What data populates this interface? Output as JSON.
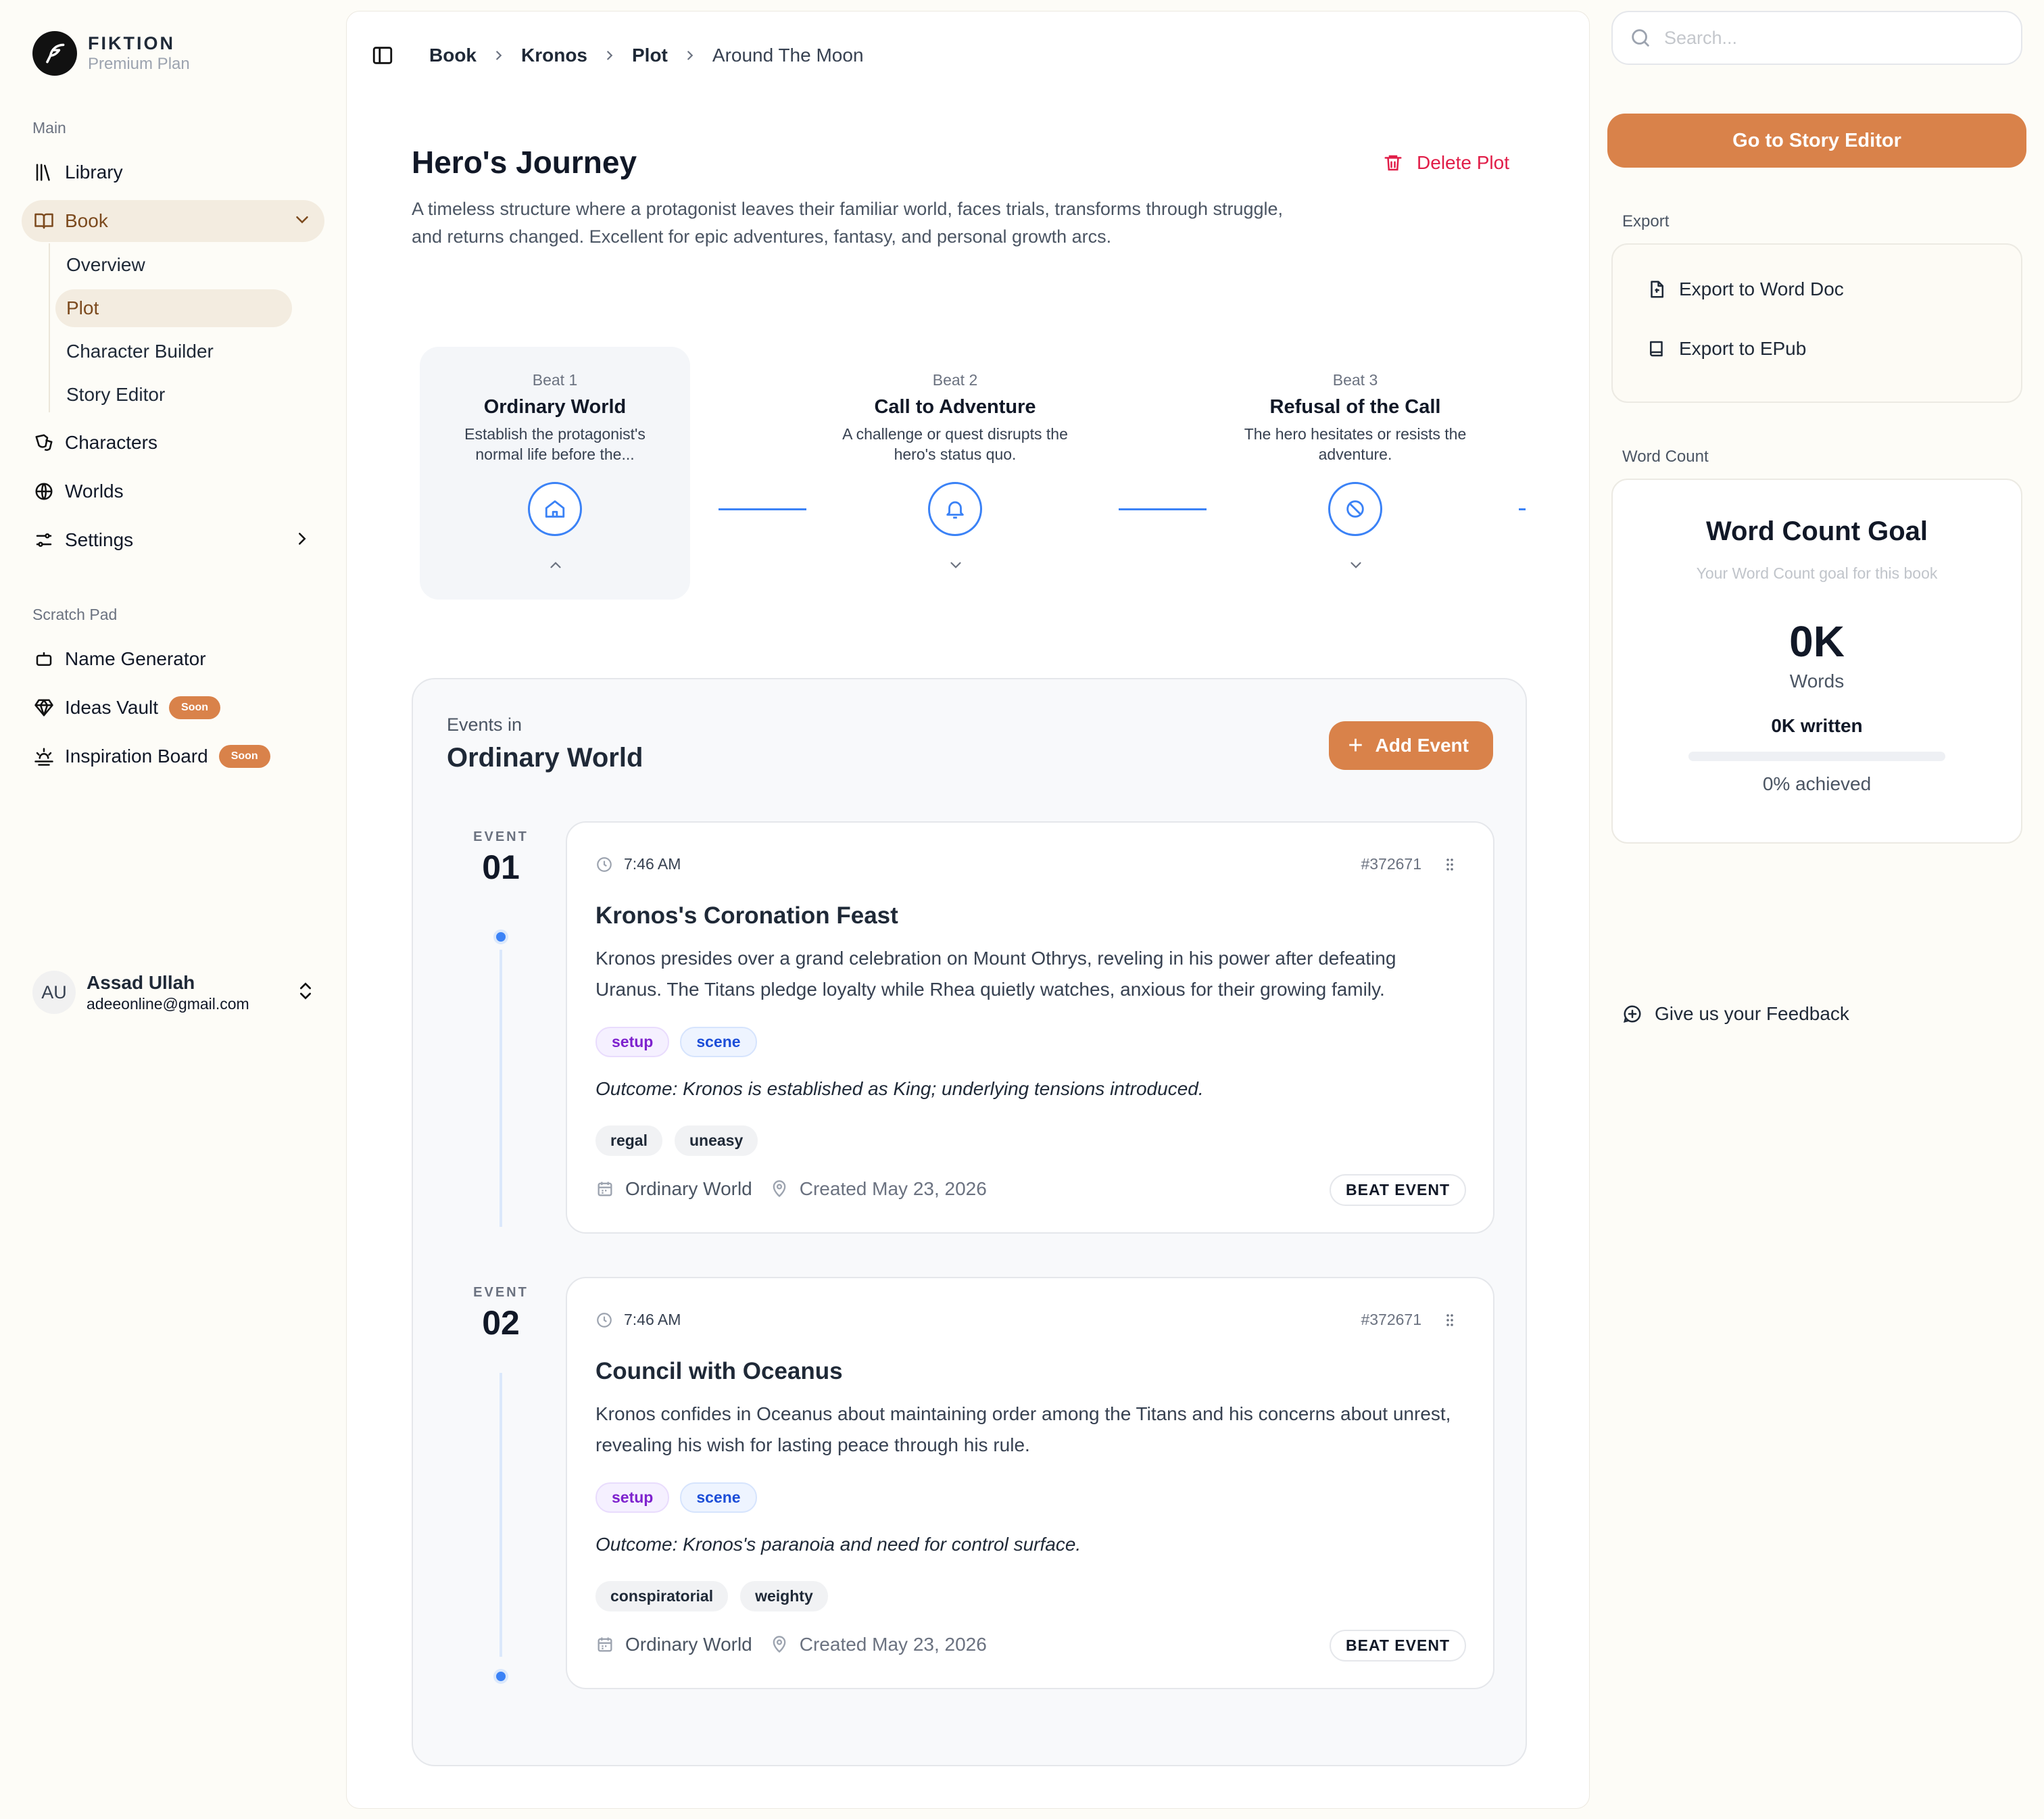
{
  "brand": {
    "name": "FIKTION",
    "plan": "Premium Plan"
  },
  "sidebar": {
    "main_label": "Main",
    "library": "Library",
    "book": "Book",
    "book_sub": [
      "Overview",
      "Plot",
      "Character Builder",
      "Story Editor"
    ],
    "characters": "Characters",
    "worlds": "Worlds",
    "settings": "Settings",
    "scratch_label": "Scratch Pad",
    "name_generator": "Name Generator",
    "ideas_vault": "Ideas Vault",
    "inspiration_board": "Inspiration Board",
    "soon_badge": "Soon"
  },
  "user": {
    "initials": "AU",
    "name": "Assad Ullah",
    "email": "adeeonline@gmail.com"
  },
  "breadcrumb": [
    "Book",
    "Kronos",
    "Plot",
    "Around The Moon"
  ],
  "plot": {
    "title": "Hero's Journey",
    "description": "A timeless structure where a protagonist leaves their familiar world, faces trials, transforms through struggle, and returns changed. Excellent for epic adventures, fantasy, and personal growth arcs.",
    "delete_label": "Delete Plot"
  },
  "beats": [
    {
      "num": "Beat 1",
      "name": "Ordinary World",
      "desc": "Establish the protagonist's normal life before the...",
      "icon": "home-icon"
    },
    {
      "num": "Beat 2",
      "name": "Call to Adventure",
      "desc": "A challenge or quest disrupts the hero's status quo.",
      "icon": "bell-icon"
    },
    {
      "num": "Beat 3",
      "name": "Refusal of the Call",
      "desc": "The hero hesitates or resists the adventure.",
      "icon": "ban-icon"
    }
  ],
  "events": {
    "label": "Events in",
    "beat_name": "Ordinary World",
    "add_label": "Add Event",
    "index_label": "EVENT",
    "items": [
      {
        "num": "01",
        "time": "7:46 AM",
        "id": "#372671",
        "title": "Kronos's Coronation Feast",
        "desc": "Kronos presides over a grand celebration on Mount Othrys, reveling in his power after defeating Uranus. The Titans pledge loyalty while Rhea quietly watches, anxious for their growing family.",
        "tags": [
          "setup",
          "scene"
        ],
        "outcome": "Outcome: Kronos is established as King; underlying tensions introduced.",
        "moods": [
          "regal",
          "uneasy"
        ],
        "beat": "Ordinary World",
        "created": "Created May 23, 2026",
        "badge": "BEAT EVENT"
      },
      {
        "num": "02",
        "time": "7:46 AM",
        "id": "#372671",
        "title": "Council with Oceanus",
        "desc": "Kronos confides in Oceanus about maintaining order among the Titans and his concerns about unrest, revealing his wish for lasting peace through his rule.",
        "tags": [
          "setup",
          "scene"
        ],
        "outcome": "Outcome: Kronos's paranoia and need for control surface.",
        "moods": [
          "conspiratorial",
          "weighty"
        ],
        "beat": "Ordinary World",
        "created": "Created May 23, 2026",
        "badge": "BEAT EVENT"
      }
    ]
  },
  "right": {
    "search_placeholder": "Search...",
    "go_editor": "Go to Story Editor",
    "export_label": "Export",
    "export_word": "Export to Word Doc",
    "export_epub": "Export to EPub",
    "wordcount_label": "Word Count",
    "wc_title": "Word Count Goal",
    "wc_sub": "Your Word Count goal for this book",
    "wc_num": "0K",
    "wc_unit": "Words",
    "wc_written": "0K written",
    "wc_progress": 0,
    "wc_pct": "0% achieved",
    "feedback": "Give us your Feedback"
  },
  "colors": {
    "accent": "#d9824a",
    "active_bg": "#f3ece0",
    "timeline_blue": "#3b82f6",
    "danger": "#e11d48"
  }
}
